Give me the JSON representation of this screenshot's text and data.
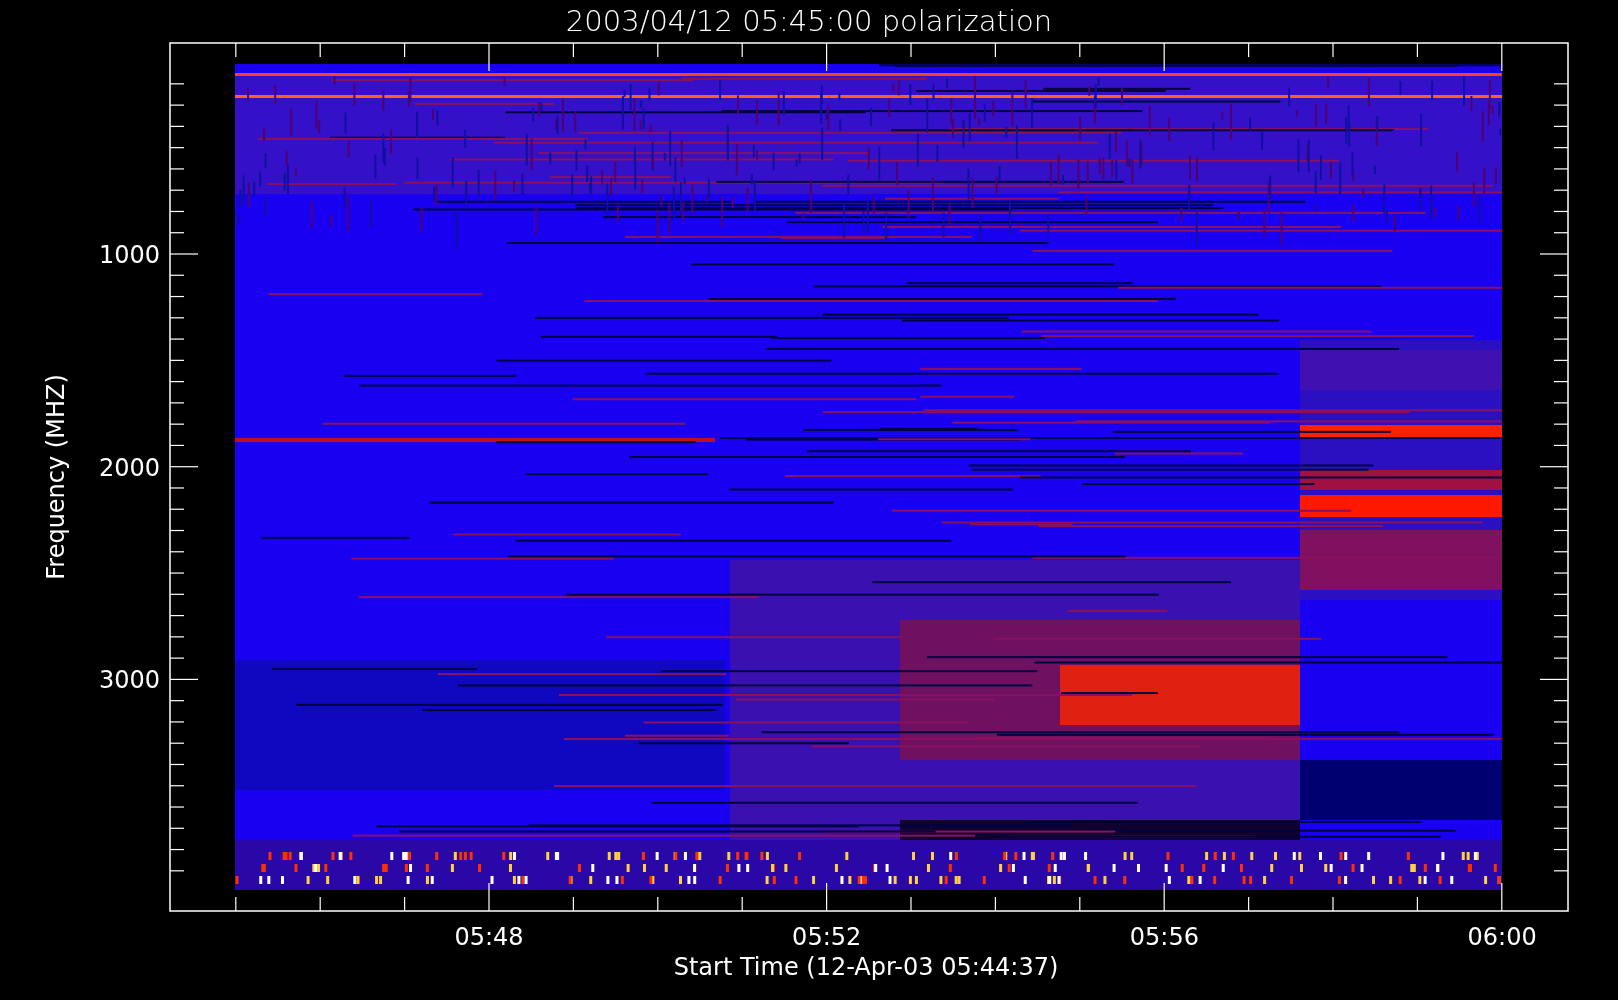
{
  "title": "2003/04/12 05:45:00 polarization",
  "y_axis": {
    "label": "Frequency (MHZ)",
    "ticks": [
      "1000",
      "2000",
      "3000"
    ]
  },
  "x_axis": {
    "label": "Start Time (12-Apr-03 05:44:37)",
    "ticks": [
      "05:48",
      "05:52",
      "05:56",
      "06:00"
    ]
  }
}
